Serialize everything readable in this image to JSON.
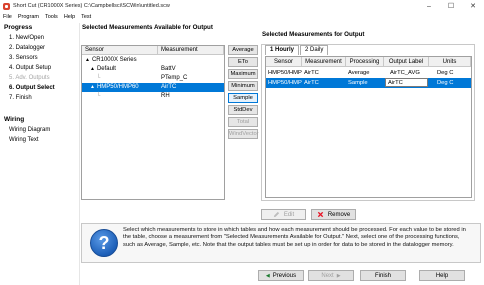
{
  "window": {
    "title": "Short Cut (CR1000X Series) C:\\Campbellsci\\SCWin\\untitled.scw",
    "minimize_glyph": "–",
    "maximize_glyph": "☐",
    "close_glyph": "✕"
  },
  "menu": [
    "File",
    "Program",
    "Tools",
    "Help",
    "Test"
  ],
  "sidebar": {
    "progress_heading": "Progress",
    "steps": [
      {
        "label": "1. New/Open",
        "state": "normal"
      },
      {
        "label": "2. Datalogger",
        "state": "normal"
      },
      {
        "label": "3. Sensors",
        "state": "normal"
      },
      {
        "label": "4. Output Setup",
        "state": "normal"
      },
      {
        "label": "5. Adv. Outputs",
        "state": "disabled"
      },
      {
        "label": "6. Output Select",
        "state": "active"
      },
      {
        "label": "7. Finish",
        "state": "normal"
      }
    ],
    "wiring_heading": "Wiring",
    "wiring_items": [
      "Wiring Diagram",
      "Wiring Text"
    ]
  },
  "available": {
    "header": "Selected Measurements Available for Output",
    "columns": [
      "Sensor",
      "Measurement"
    ],
    "rows": [
      {
        "sensor": "CR1000X Series",
        "measurement": "",
        "caret": "▲",
        "level": 0,
        "selected": false
      },
      {
        "sensor": "Default",
        "measurement": "BattV",
        "caret": "▲",
        "level": 1,
        "selected": false
      },
      {
        "sensor": "",
        "measurement": "PTemp_C",
        "caret": "",
        "level": 2,
        "selected": false
      },
      {
        "sensor": "HMP50/HMP60",
        "measurement": "AirTC",
        "caret": "▲",
        "level": 1,
        "selected": true
      },
      {
        "sensor": "",
        "measurement": "RH",
        "caret": "",
        "level": 2,
        "selected": false
      }
    ]
  },
  "processing_buttons": [
    {
      "label": "Average",
      "state": "normal"
    },
    {
      "label": "ETo",
      "state": "normal"
    },
    {
      "label": "Maximum",
      "state": "normal"
    },
    {
      "label": "Minimum",
      "state": "normal"
    },
    {
      "label": "Sample",
      "state": "highlight"
    },
    {
      "label": "StdDev",
      "state": "normal"
    },
    {
      "label": "Total",
      "state": "disabled"
    },
    {
      "label": "WindVector",
      "state": "disabled"
    }
  ],
  "output": {
    "header": "Selected Measurements for Output",
    "tabs": [
      "1 Hourly",
      "2 Daily"
    ],
    "columns": [
      "Sensor",
      "Measurement",
      "Processing",
      "Output Label",
      "Units"
    ],
    "rows": [
      {
        "sensor": "HMP50/HMP6",
        "measurement": "AirTC",
        "processing": "Average",
        "label": "AirTC_AVG",
        "units": "Deg C",
        "selected": false
      },
      {
        "sensor": "HMP50/HMP6",
        "measurement": "AirTC",
        "processing": "Sample",
        "label": "AirTC",
        "units": "Deg C",
        "selected": true
      }
    ],
    "edit_label": "Edit",
    "remove_label": "Remove"
  },
  "info": {
    "icon_glyph": "?",
    "text": "Select which measurements to store in which tables and how each measurement should be processed. For each value to be stored in the table, choose a measurement from \"Selected Measurements Available for Output.\" Next, select one of the processing functions, such as Average, Sample, etc. Note that the output tables must be set up in order for data to be stored in the datalogger memory."
  },
  "footer": {
    "previous": "Previous",
    "next": "Next",
    "finish": "Finish",
    "help": "Help",
    "previous_glyph": "◀",
    "next_glyph": "▶"
  },
  "colors": {
    "selection": "#0078d7",
    "remove_icon": "#e81123"
  }
}
